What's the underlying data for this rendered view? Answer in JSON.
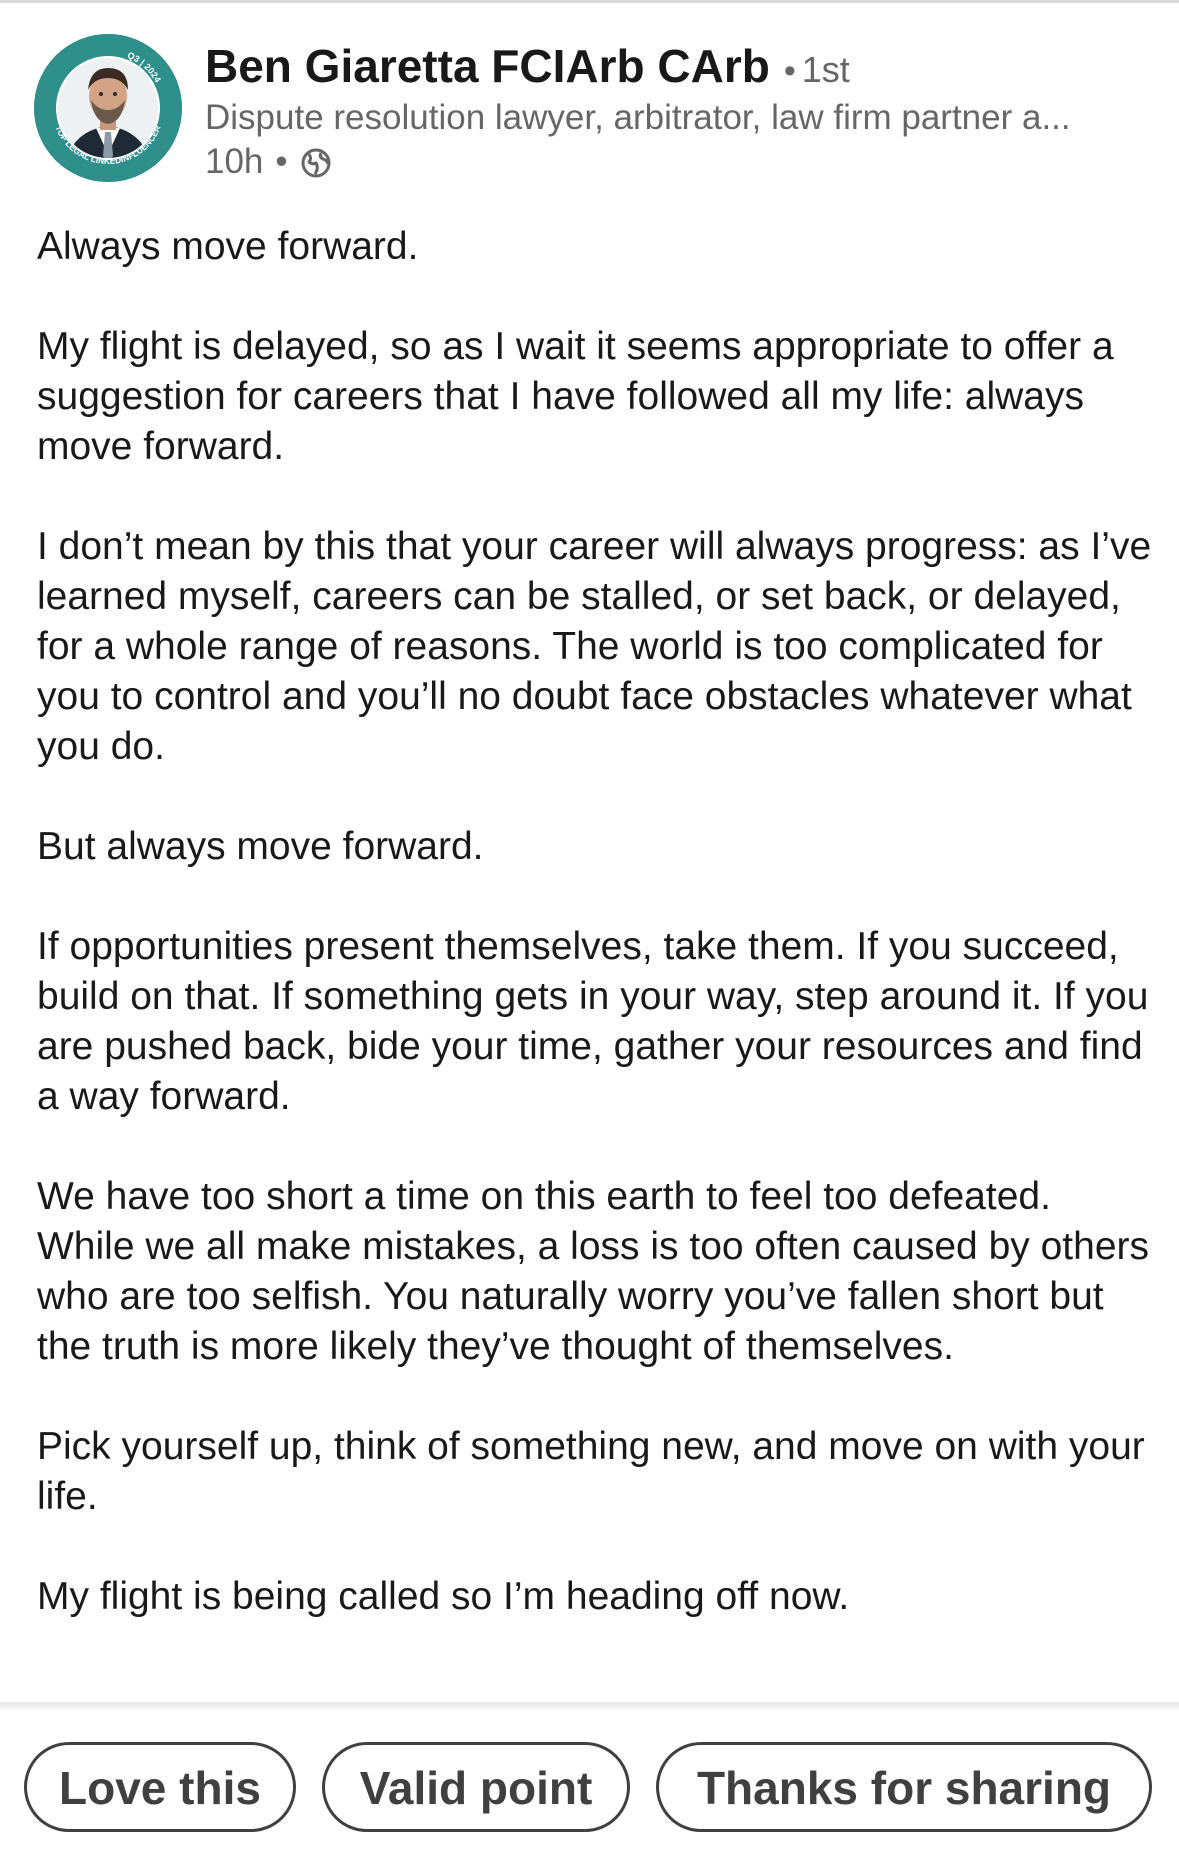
{
  "post": {
    "author": {
      "name": "Ben Giaretta FCIArb CArb",
      "separator": "•",
      "connection_degree": "1st",
      "headline": "Dispute resolution lawyer, arbitrator, law firm partner a...",
      "avatar_badge_top": "Q3 | 2024",
      "avatar_badge_bottom": "TOP LEGAL LINKEDINFLUENCER"
    },
    "meta": {
      "time": "10h",
      "separator": "•",
      "visibility_icon": "globe-icon"
    },
    "paragraphs": [
      "Always move forward.",
      "My flight is delayed, so as I wait it seems appropriate to offer a suggestion for careers that I have followed all my life: always move forward.",
      "I don’t mean by this that your career will always progress: as I’ve learned myself, careers can be stalled, or set back, or delayed, for a whole range of reasons. The world is too complicated for you to control and you’ll no doubt face obstacles whatever what you do.",
      "But always move forward.",
      "If opportunities present themselves, take them. If you succeed, build on that. If something gets in your way, step around it. If you are pushed back, bide your time, gather your resources and find a way forward.",
      "We have too short a time on this earth to feel too defeated. While we all make mistakes, a loss is too often caused by others who are too selfish. You naturally worry you’ve fallen short but the truth is more likely they’ve thought of themselves.",
      "Pick yourself up, think of something new, and move on with your life.",
      "My flight is being called so I’m heading off now."
    ]
  },
  "quick_replies": [
    "Love this",
    "Valid point",
    "Thanks for sharing"
  ],
  "colors": {
    "text_primary": "#191919",
    "text_secondary": "#666666",
    "avatar_ring": "#2f8f8a",
    "chip_border": "#404040"
  }
}
